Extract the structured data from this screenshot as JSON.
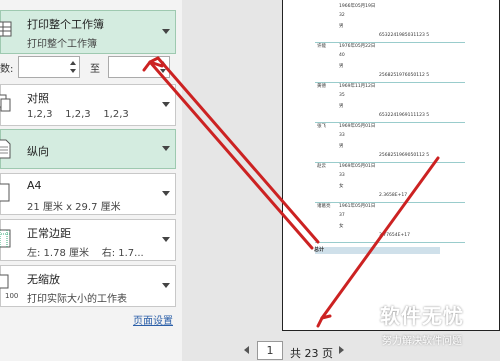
{
  "settings": {
    "print_what": {
      "title": "打印整个工作簿",
      "subtitle": "打印整个工作簿"
    },
    "pages": {
      "from_label": "数:",
      "to_label": "至",
      "from_value": "",
      "to_value": ""
    },
    "collate": {
      "title": "对照",
      "subtitle": "1,2,3    1,2,3    1,2,3"
    },
    "orientation": {
      "title": "纵向"
    },
    "paper": {
      "title": "A4",
      "subtitle": "21 厘米 x 29.7 厘米"
    },
    "margins": {
      "title": "正常边距",
      "subtitle": "左: 1.78 厘米    右: 1.7..."
    },
    "scaling": {
      "title": "无缩放",
      "subtitle": "打印实际大小的工作表",
      "icon_text": "100"
    },
    "page_setup_link": "页面设置"
  },
  "preview": {
    "rows": [
      {
        "a": "",
        "b": "1966年05月19日",
        "c": ""
      },
      {
        "a": "",
        "b": "32",
        "c": ""
      },
      {
        "a": "",
        "b": "男",
        "c": ""
      },
      {
        "a": "",
        "b": "",
        "c": "6532241985031123 5"
      },
      {
        "a": "许能",
        "b": "1976年05月22日",
        "c": ""
      },
      {
        "a": "",
        "b": "40",
        "c": ""
      },
      {
        "a": "",
        "b": "男",
        "c": ""
      },
      {
        "a": "",
        "b": "",
        "c": "2568251976050112 5"
      },
      {
        "a": "黄德",
        "b": "1969年11月12日",
        "c": ""
      },
      {
        "a": "",
        "b": "35",
        "c": ""
      },
      {
        "a": "",
        "b": "男",
        "c": ""
      },
      {
        "a": "",
        "b": "",
        "c": "6532241969111123 5"
      },
      {
        "a": "张飞",
        "b": "1969年05月01日",
        "c": ""
      },
      {
        "a": "",
        "b": "33",
        "c": ""
      },
      {
        "a": "",
        "b": "男",
        "c": ""
      },
      {
        "a": "",
        "b": "",
        "c": "2568251969050112 5"
      },
      {
        "a": "赵云",
        "b": "1969年05月01日",
        "c": ""
      },
      {
        "a": "",
        "b": "33",
        "c": ""
      },
      {
        "a": "",
        "b": "女",
        "c": ""
      },
      {
        "a": "",
        "b": "",
        "c": "2.3658E+17"
      },
      {
        "a": "诸葛亮",
        "b": "1961年05月01日",
        "c": ""
      },
      {
        "a": "",
        "b": "37",
        "c": ""
      },
      {
        "a": "",
        "b": "女",
        "c": ""
      },
      {
        "a": "",
        "b": "",
        "c": "3.77654E+17"
      }
    ],
    "total_label": "总计"
  },
  "status": {
    "current_page": "1",
    "total_text": "共 23 页"
  },
  "watermark": {
    "title": "软件无忧",
    "subtitle": "努力解决软件问题"
  },
  "colors": {
    "selected": "#d4ece0",
    "arrow": "#cc2222",
    "link": "#2b5fa8"
  }
}
